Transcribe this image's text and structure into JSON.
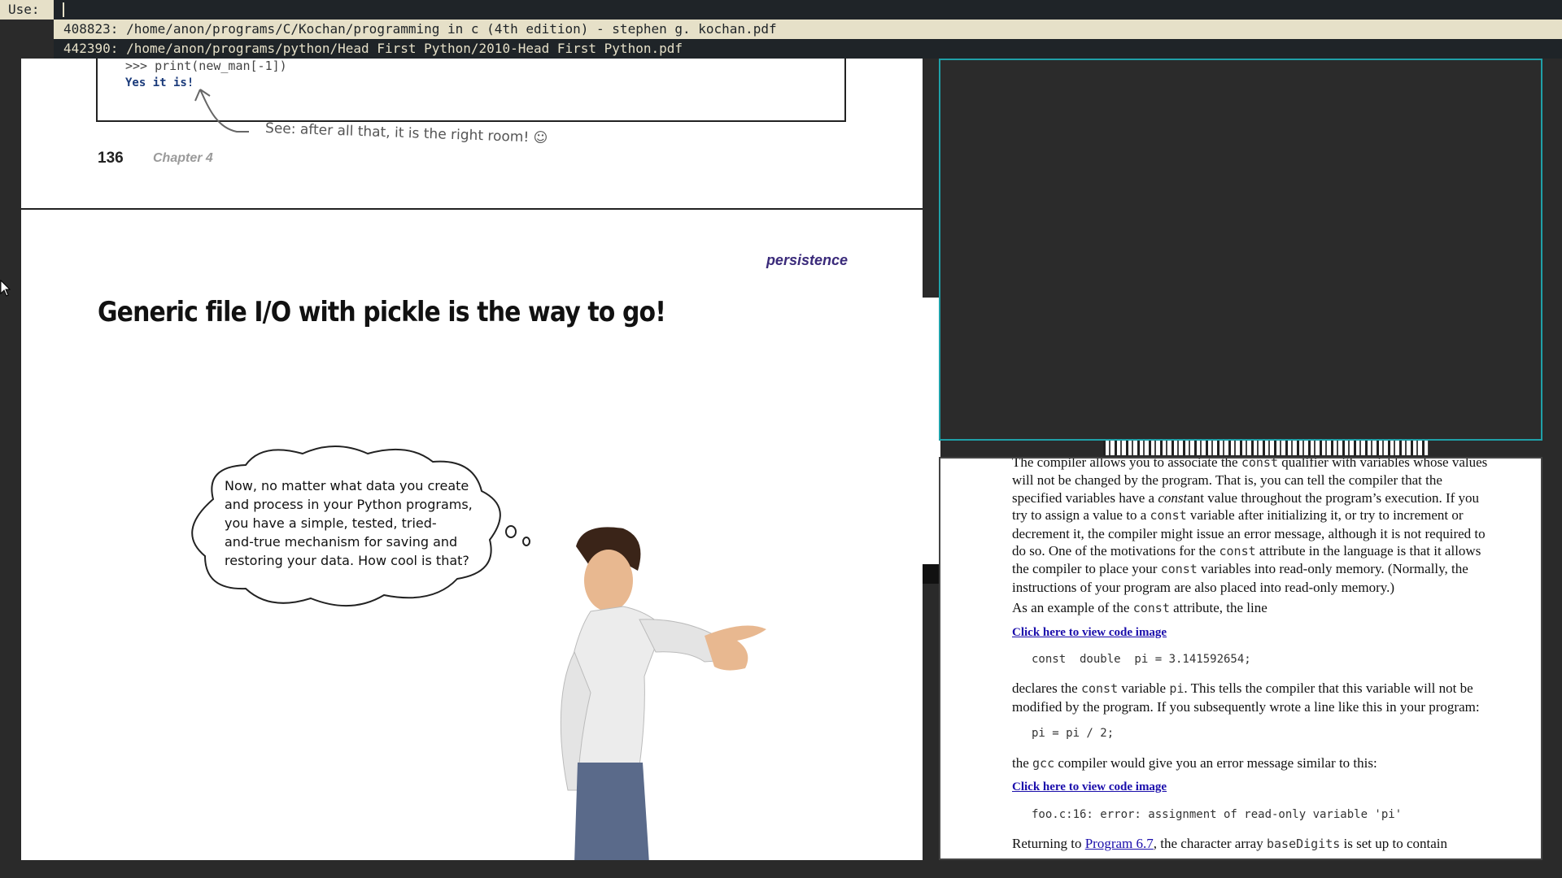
{
  "prompt": {
    "label": "Use:",
    "value": "",
    "results": [
      {
        "text": "408823: /home/anon/programs/C/Kochan/programming in c (4th edition) - stephen g. kochan.pdf",
        "selected": true
      },
      {
        "text": "442390: /home/anon/programs/python/Head First Python/2010-Head First Python.pdf",
        "selected": false
      }
    ]
  },
  "left_pdf": {
    "code_partial": ">>> print(new_man[-1])",
    "code_output": "Yes it is!",
    "annotation": "See: after all that, it is the right room! ☺",
    "page_number": "136",
    "chapter": "Chapter 4",
    "section_label": "persistence",
    "heading": "Generic file I/O with pickle is the way to go!",
    "thought_lines": [
      "Now, no matter what data you create",
      "and process in your Python programs,",
      "you have a simple, tested, tried-",
      "and-true mechanism for saving and",
      "restoring your data. How cool is that?"
    ]
  },
  "right_ebook": {
    "p1_a": "The compiler allows you to associate the ",
    "p1_b": "const",
    "p1_c": " qualifier with variables whose values will not be changed by the program. That is, you can tell the compiler that the specified variables have a ",
    "p1_d": "const",
    "p1_e": "ant value throughout the program’s execution. If you try to assign a value to a ",
    "p1_f": "const",
    "p1_g": " variable after initializing it, or try to increment or decrement it, the compiler might issue an error message, although it is not required to do so. One of the motivations for the ",
    "p1_h": "const",
    "p1_i": " attribute in the language is that it allows the compiler to place your ",
    "p1_j": "const",
    "p1_k": " variables into read-only memory. (Normally, the instructions of your program are also placed into read-only memory.)",
    "p2_a": "As an example of the ",
    "p2_b": "const",
    "p2_c": " attribute, the line",
    "code_link_1": "Click here to view code image",
    "code_1": "const  double  pi = 3.141592654;",
    "p3_a": "declares the ",
    "p3_b": "const",
    "p3_c": " variable ",
    "p3_d": "pi",
    "p3_e": ". This tells the compiler that this variable will not be modified by the program. If you subsequently wrote a line like this in your program:",
    "code_2": "pi = pi / 2;",
    "p4_a": "the ",
    "p4_b": "gcc",
    "p4_c": " compiler would give you an error message similar to this:",
    "code_link_2": "Click here to view code image",
    "code_3": "foo.c:16: error: assignment of read-only variable 'pi'",
    "p5_a": "Returning to ",
    "p5_link": "Program 6.7",
    "p5_b": ", the character array ",
    "p5_c": "baseDigits",
    "p5_d": " is set up to contain"
  },
  "colors": {
    "bar_bg": "#1f2428",
    "bar_fg": "#e6e0c8",
    "focus_border": "#1fa0a8",
    "link": "#1a0dab",
    "section_label": "#3a2a7a"
  }
}
